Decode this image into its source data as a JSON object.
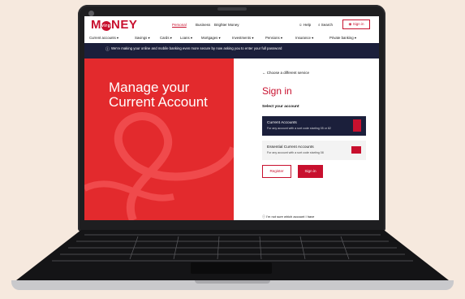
{
  "header": {
    "logo_text": "M NEY",
    "logo_badge": "virgin",
    "segments": [
      "Personal",
      "Business",
      "Brighter Money"
    ],
    "help": "Help",
    "search": "Search",
    "signin": "Sign in"
  },
  "nav": {
    "items": [
      "Current accounts ▾",
      "Savings ▾",
      "Cards ▾",
      "Loans ▾",
      "Mortgages ▾",
      "Investments ▾",
      "Pensions ▾",
      "Insurance ▾",
      "Private banking ▾"
    ]
  },
  "banner": {
    "icon": "info-icon",
    "text": "We're making your online and mobile banking even more secure by now asking you to enter your full password"
  },
  "hero": {
    "title": "Manage your Current Account"
  },
  "panel": {
    "back_link": "Choose a different service",
    "title": "Sign in",
    "select_label": "Select your account",
    "accounts": [
      {
        "title": "Current Accounts",
        "subtitle": "For any account with a sort code starting 05 or 82"
      },
      {
        "title": "Essential Current Accounts",
        "subtitle": "For any account with a sort code starting 08"
      }
    ],
    "register": "Register",
    "signin": "Sign in",
    "help": "I'm not sure which account I have"
  },
  "colors": {
    "brand": "#c8102e",
    "hero": "#e32a2d",
    "navy": "#1b1f3b"
  }
}
